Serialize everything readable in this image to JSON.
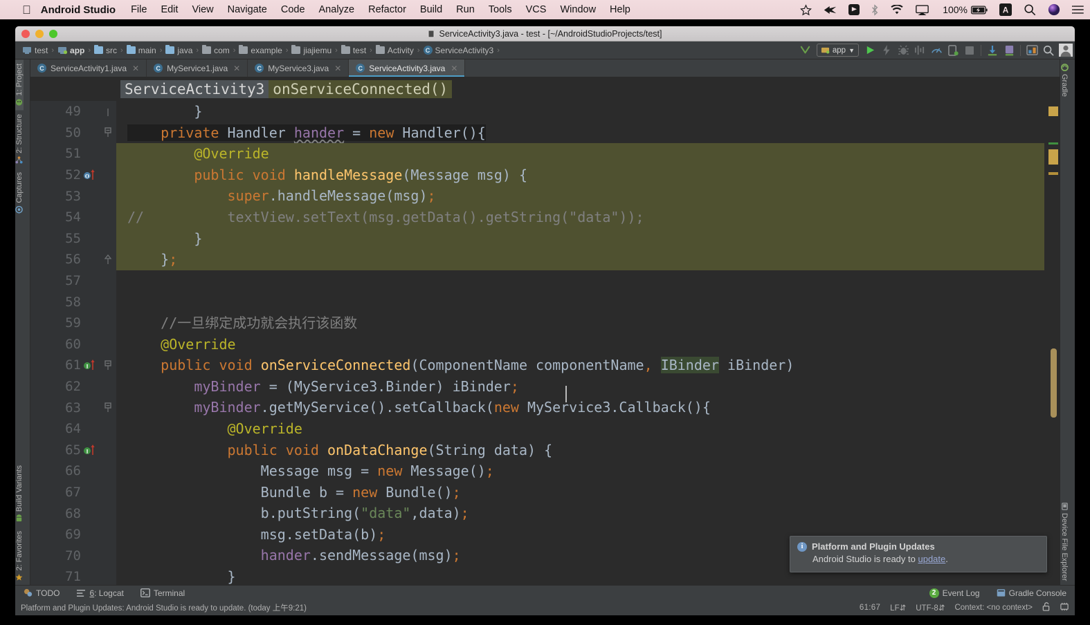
{
  "macbar": {
    "apple_glyph": "",
    "app_name": "Android Studio",
    "menus": [
      "File",
      "Edit",
      "View",
      "Navigate",
      "Code",
      "Analyze",
      "Refactor",
      "Build",
      "Run",
      "Tools",
      "VCS",
      "Window",
      "Help"
    ],
    "right_icons": [
      "star-icon",
      "flag-icon",
      "dropbox-icon",
      "bluetooth-icon",
      "wifi-icon",
      "airplay-icon"
    ],
    "battery_percent": "100%",
    "battery_icon": "battery-charging-icon",
    "input_source": "A",
    "search_icon": "search-icon",
    "siri_icon": "siri-icon",
    "notifications_icon": "notification-center-icon"
  },
  "window": {
    "title": "ServiceActivity3.java - test - [~/AndroidStudioProjects/test]",
    "title_icon": "android-device-icon"
  },
  "navbar": {
    "breadcrumbs": [
      {
        "label": "test",
        "icon": "module-icon",
        "bold": false
      },
      {
        "label": "app",
        "icon": "module-app-icon",
        "bold": true
      },
      {
        "label": "src",
        "icon": "folder-icon",
        "bold": false
      },
      {
        "label": "main",
        "icon": "folder-icon",
        "bold": false
      },
      {
        "label": "java",
        "icon": "folder-source-icon",
        "bold": false
      },
      {
        "label": "com",
        "icon": "package-icon",
        "bold": false
      },
      {
        "label": "example",
        "icon": "package-icon",
        "bold": false
      },
      {
        "label": "jiajiemu",
        "icon": "package-icon",
        "bold": false
      },
      {
        "label": "test",
        "icon": "package-icon",
        "bold": false
      },
      {
        "label": "Activity",
        "icon": "package-icon",
        "bold": false
      },
      {
        "label": "ServiceActivity3",
        "icon": "class-icon",
        "bold": false
      }
    ],
    "run_config": "app",
    "toolbar_icons": [
      "build-hammer-icon",
      "run-icon",
      "apply-changes-icon",
      "debug-icon",
      "profile-icon",
      "monitor-icon",
      "avd-manager-icon",
      "stop-icon",
      "sdk-manager-icon",
      "sync-gradle-icon",
      "layout-inspector-icon",
      "search-everywhere-icon",
      "user-avatar-icon"
    ]
  },
  "left_strip": {
    "top": [
      {
        "label": "1: Project",
        "icon": "project-icon",
        "selected": true
      },
      {
        "label": "2: Structure",
        "icon": "structure-icon",
        "selected": false
      },
      {
        "label": "Captures",
        "icon": "captures-icon",
        "selected": false
      }
    ],
    "bottom": [
      {
        "label": "Build Variants",
        "icon": "android-icon",
        "selected": false
      },
      {
        "label": "2: Favorites",
        "icon": "star-icon",
        "selected": false
      }
    ]
  },
  "right_strip": {
    "top": [
      {
        "label": "Gradle",
        "icon": "gradle-icon",
        "selected": false
      }
    ],
    "bottom": [
      {
        "label": "Device File Explorer",
        "icon": "device-file-icon",
        "selected": false
      }
    ]
  },
  "tabs": [
    {
      "label": "ServiceActivity1.java",
      "icon": "java-class-icon",
      "active": false
    },
    {
      "label": "MyService1.java",
      "icon": "java-class-icon",
      "active": false
    },
    {
      "label": "MyService3.java",
      "icon": "java-class-icon",
      "active": false
    },
    {
      "label": "ServiceActivity3.java",
      "icon": "java-class-icon",
      "active": true
    }
  ],
  "breadcrumbs_editor": {
    "class": "ServiceActivity3",
    "method": "onServiceConnected()"
  },
  "editor": {
    "first_line_number": 49,
    "lines": [
      {
        "n": 49,
        "indent": 0,
        "block": false,
        "gutter": null,
        "fold": "fold-end-small",
        "tokens": [
          {
            "t": "        }",
            "c": "punc"
          }
        ]
      },
      {
        "n": 50,
        "indent": 0,
        "block": false,
        "gutter": null,
        "fold": "fold-open",
        "highlight": "dark",
        "tokens": [
          {
            "t": "    ",
            "c": "nm"
          },
          {
            "t": "private",
            "c": "kw"
          },
          {
            "t": " ",
            "c": "nm"
          },
          {
            "t": "Handler",
            "c": "nm"
          },
          {
            "t": " ",
            "c": "nm"
          },
          {
            "t": "hander",
            "c": "fld wavy"
          },
          {
            "t": " = ",
            "c": "nm"
          },
          {
            "t": "new",
            "c": "kw"
          },
          {
            "t": " ",
            "c": "nm"
          },
          {
            "t": "Handler(){",
            "c": "nm"
          }
        ]
      },
      {
        "n": 51,
        "indent": 0,
        "block": true,
        "gutter": null,
        "fold": null,
        "tokens": [
          {
            "t": "        ",
            "c": "nm"
          },
          {
            "t": "@Override",
            "c": "ann"
          }
        ]
      },
      {
        "n": 52,
        "indent": 0,
        "block": true,
        "gutter": "override-method",
        "fold": null,
        "tokens": [
          {
            "t": "        ",
            "c": "nm"
          },
          {
            "t": "public",
            "c": "kw"
          },
          {
            "t": " ",
            "c": "nm"
          },
          {
            "t": "void",
            "c": "kw"
          },
          {
            "t": " ",
            "c": "nm"
          },
          {
            "t": "handleMessage",
            "c": "fn"
          },
          {
            "t": "(Message msg) {",
            "c": "nm"
          }
        ]
      },
      {
        "n": 53,
        "indent": 0,
        "block": true,
        "gutter": null,
        "fold": null,
        "tokens": [
          {
            "t": "            ",
            "c": "nm"
          },
          {
            "t": "super",
            "c": "kw"
          },
          {
            "t": ".handleMessage(msg)",
            "c": "nm"
          },
          {
            "t": ";",
            "c": "semi"
          }
        ]
      },
      {
        "n": 54,
        "indent": 0,
        "block": true,
        "gutter": null,
        "fold": null,
        "tokens": [
          {
            "t": "//          textView.setText(msg.getData().getString(\"data\"));",
            "c": "cmt"
          }
        ],
        "comment_offset": true
      },
      {
        "n": 55,
        "indent": 0,
        "block": true,
        "gutter": null,
        "fold": null,
        "tokens": [
          {
            "t": "        }",
            "c": "nm"
          }
        ]
      },
      {
        "n": 56,
        "indent": 0,
        "block": true,
        "gutter": null,
        "fold": "fold-end",
        "tokens": [
          {
            "t": "    }",
            "c": "nm"
          },
          {
            "t": ";",
            "c": "semi"
          }
        ]
      },
      {
        "n": 57,
        "indent": 0,
        "block": false,
        "gutter": null,
        "fold": null,
        "tokens": []
      },
      {
        "n": 58,
        "indent": 0,
        "block": false,
        "gutter": null,
        "fold": null,
        "tokens": []
      },
      {
        "n": 59,
        "indent": 0,
        "block": false,
        "gutter": null,
        "fold": null,
        "tokens": [
          {
            "t": "    //一旦绑定成功就会执行该函数",
            "c": "cmt"
          }
        ]
      },
      {
        "n": 60,
        "indent": 0,
        "block": false,
        "gutter": null,
        "fold": null,
        "tokens": [
          {
            "t": "    ",
            "c": "nm"
          },
          {
            "t": "@Override",
            "c": "ann"
          }
        ]
      },
      {
        "n": 61,
        "indent": 0,
        "block": false,
        "gutter": "implementing-method",
        "fold": "fold-open",
        "bulb": true,
        "tokens": [
          {
            "t": "    ",
            "c": "nm"
          },
          {
            "t": "public",
            "c": "kw"
          },
          {
            "t": " ",
            "c": "nm"
          },
          {
            "t": "void",
            "c": "kw"
          },
          {
            "t": " ",
            "c": "nm"
          },
          {
            "t": "onServiceConnected",
            "c": "fn"
          },
          {
            "t": "(ComponentName componentName",
            "c": "nm"
          },
          {
            "t": ",",
            "c": "semi"
          },
          {
            "t": " ",
            "c": "nm"
          },
          {
            "t": "IBinder",
            "c": "nm hl-green"
          },
          {
            "t": " iBinder)",
            "c": "nm"
          }
        ]
      },
      {
        "n": 62,
        "indent": 0,
        "block": false,
        "gutter": null,
        "fold": null,
        "tokens": [
          {
            "t": "        ",
            "c": "nm"
          },
          {
            "t": "myBinder",
            "c": "fld"
          },
          {
            "t": " = (MyService3.Binder) iBinder",
            "c": "nm"
          },
          {
            "t": ";",
            "c": "semi"
          }
        ]
      },
      {
        "n": 63,
        "indent": 0,
        "block": false,
        "gutter": null,
        "fold": "fold-open",
        "tokens": [
          {
            "t": "        ",
            "c": "nm"
          },
          {
            "t": "myBinder",
            "c": "fld"
          },
          {
            "t": ".getMyService().setCallback(",
            "c": "nm"
          },
          {
            "t": "new",
            "c": "kw"
          },
          {
            "t": " MyService3.Callback(){",
            "c": "nm"
          }
        ]
      },
      {
        "n": 64,
        "indent": 0,
        "block": false,
        "gutter": null,
        "fold": null,
        "tokens": [
          {
            "t": "            ",
            "c": "nm"
          },
          {
            "t": "@Override",
            "c": "ann"
          }
        ]
      },
      {
        "n": 65,
        "indent": 0,
        "block": false,
        "gutter": "implementing-method",
        "fold": null,
        "tokens": [
          {
            "t": "            ",
            "c": "nm"
          },
          {
            "t": "public",
            "c": "kw"
          },
          {
            "t": " ",
            "c": "nm"
          },
          {
            "t": "void",
            "c": "kw"
          },
          {
            "t": " ",
            "c": "nm"
          },
          {
            "t": "onDataChange",
            "c": "fn"
          },
          {
            "t": "(String data) {",
            "c": "nm"
          }
        ]
      },
      {
        "n": 66,
        "indent": 0,
        "block": false,
        "gutter": null,
        "fold": null,
        "tokens": [
          {
            "t": "                Message msg = ",
            "c": "nm"
          },
          {
            "t": "new",
            "c": "kw"
          },
          {
            "t": " Message()",
            "c": "nm"
          },
          {
            "t": ";",
            "c": "semi"
          }
        ]
      },
      {
        "n": 67,
        "indent": 0,
        "block": false,
        "gutter": null,
        "fold": null,
        "tokens": [
          {
            "t": "                Bundle b = ",
            "c": "nm"
          },
          {
            "t": "new",
            "c": "kw"
          },
          {
            "t": " Bundle()",
            "c": "nm"
          },
          {
            "t": ";",
            "c": "semi"
          }
        ]
      },
      {
        "n": 68,
        "indent": 0,
        "block": false,
        "gutter": null,
        "fold": null,
        "tokens": [
          {
            "t": "                b.putString(",
            "c": "nm"
          },
          {
            "t": "\"data\"",
            "c": "str"
          },
          {
            "t": ",data)",
            "c": "nm"
          },
          {
            "t": ";",
            "c": "semi"
          }
        ]
      },
      {
        "n": 69,
        "indent": 0,
        "block": false,
        "gutter": null,
        "fold": null,
        "tokens": [
          {
            "t": "                msg.setData(b)",
            "c": "nm"
          },
          {
            "t": ";",
            "c": "semi"
          }
        ]
      },
      {
        "n": 70,
        "indent": 0,
        "block": false,
        "gutter": null,
        "fold": null,
        "tokens": [
          {
            "t": "                ",
            "c": "nm"
          },
          {
            "t": "hander",
            "c": "fld"
          },
          {
            "t": ".sendMessage(msg)",
            "c": "nm"
          },
          {
            "t": ";",
            "c": "semi"
          }
        ]
      },
      {
        "n": 71,
        "indent": 0,
        "block": false,
        "gutter": null,
        "fold": null,
        "tokens": [
          {
            "t": "            }",
            "c": "nm"
          }
        ]
      }
    ]
  },
  "balloon": {
    "icon": "info-icon",
    "title": "Platform and Plugin Updates",
    "body_before": "Android Studio is ready to ",
    "link": "update",
    "body_after": "."
  },
  "bottom_tools": [
    {
      "label": "TODO",
      "icon": "todo-icon"
    },
    {
      "label": "6: Logcat",
      "icon": "logcat-icon",
      "mnemonic": "6"
    },
    {
      "label": "Terminal",
      "icon": "terminal-icon"
    }
  ],
  "bottom_right_tools": [
    {
      "label": "Event Log",
      "icon": "event-log-icon",
      "badge": "2"
    },
    {
      "label": "Gradle Console",
      "icon": "gradle-console-icon"
    }
  ],
  "statusbar": {
    "message": "Platform and Plugin Updates: Android Studio is ready to update. (today 上午9:21)",
    "caret": "61:67",
    "line_separator": "LF",
    "encoding": "UTF-8",
    "context": "Context: <no context>",
    "lock_icon": "unlocked-icon",
    "memory_icon": "memory-icon"
  },
  "colors": {
    "editor_bg": "#2b2b2b",
    "gutter_bg": "#313335",
    "chrome_bg": "#3c3f41",
    "block_highlight": "#4f5130",
    "tab_accent": "#4e9ec7",
    "keyword": "#cc7832",
    "method": "#ffc66d",
    "field": "#9876aa",
    "annotation": "#bbb529",
    "string": "#6a8759",
    "comment": "#808080",
    "text": "#a9b7c6"
  }
}
